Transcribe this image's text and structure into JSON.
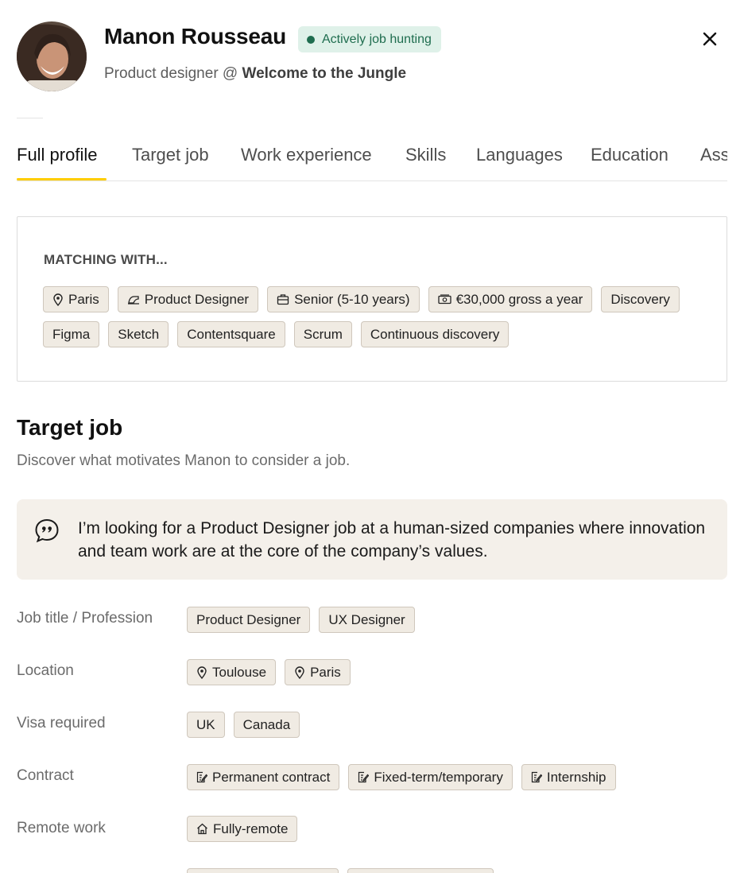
{
  "profile": {
    "name": "Manon  Rousseau",
    "status": "Actively job hunting",
    "role": "Product designer @",
    "company": "Welcome to the Jungle"
  },
  "tabs": [
    {
      "label": "Full profile"
    },
    {
      "label": "Target job"
    },
    {
      "label": "Work experience"
    },
    {
      "label": "Skills"
    },
    {
      "label": "Languages"
    },
    {
      "label": "Education"
    },
    {
      "label": "Ass"
    }
  ],
  "matching": {
    "title": "MATCHING WITH...",
    "chips_row1": [
      {
        "label": "Paris",
        "icon": "location-pin-icon"
      },
      {
        "label": "Product Designer",
        "icon": "job-title-icon"
      },
      {
        "label": "Senior (5-10 years)",
        "icon": "briefcase-icon"
      },
      {
        "label": "€30,000 gross a year",
        "icon": "money-icon"
      },
      {
        "label": "Discovery",
        "icon": ""
      }
    ],
    "chips_row2": [
      {
        "label": "Figma"
      },
      {
        "label": "Sketch"
      },
      {
        "label": "Contentsquare"
      },
      {
        "label": "Scrum"
      },
      {
        "label": "Continuous discovery"
      }
    ]
  },
  "target_job": {
    "title": "Target job",
    "description": "Discover what motivates Manon to consider a job.",
    "quote": "I’m looking for a Product Designer job at a human-sized companies where innovation and team work are at the core of the company’s values.",
    "rows": [
      {
        "label": "Job title / Profession",
        "chips": [
          {
            "label": "Product Designer"
          },
          {
            "label": "UX Designer"
          }
        ]
      },
      {
        "label": "Location",
        "chips": [
          {
            "label": "Toulouse",
            "icon": "location-pin-icon"
          },
          {
            "label": "Paris",
            "icon": "location-pin-icon"
          }
        ]
      },
      {
        "label": "Visa required",
        "chips": [
          {
            "label": "UK"
          },
          {
            "label": "Canada"
          }
        ]
      },
      {
        "label": "Contract",
        "chips": [
          {
            "label": "Permanent contract",
            "icon": "contract-icon"
          },
          {
            "label": "Fixed-term/temporary",
            "icon": "contract-icon"
          },
          {
            "label": "Internship",
            "icon": "contract-icon"
          }
        ]
      },
      {
        "label": "Remote work",
        "chips": [
          {
            "label": "Fully-remote",
            "icon": "remote-house-icon"
          }
        ]
      }
    ]
  },
  "colors": {
    "accent_underline": "#ffcd00",
    "status_bg": "#dff1e9",
    "status_text": "#1f6d4f",
    "chip_bg": "#f0ebe3",
    "quote_bg": "#f4f0ea"
  }
}
